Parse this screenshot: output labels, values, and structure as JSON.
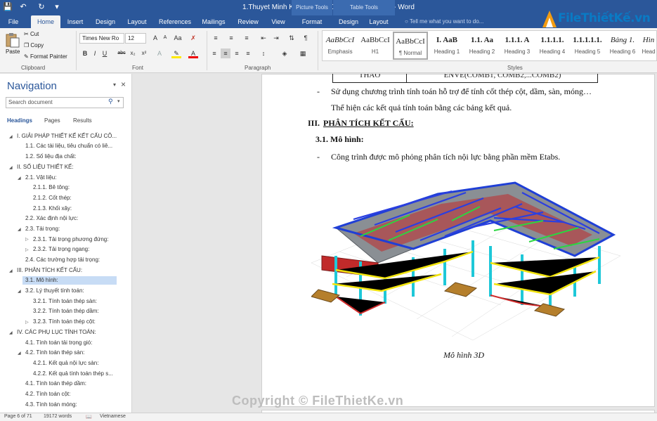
{
  "title": "1.Thuyet Minh KC (1).docx [Compatibility Mode] - Word",
  "context_tabs": {
    "picture": "Picture Tools",
    "table": "Table Tools"
  },
  "tabs": [
    "File",
    "Home",
    "Insert",
    "Design",
    "Layout",
    "References",
    "Mailings",
    "Review",
    "View",
    "Format",
    "Design",
    "Layout"
  ],
  "tell_me": "Tell me what you want to do...",
  "logo": "FileThiếtKế.vn",
  "clipboard": {
    "paste": "Paste",
    "cut": "Cut",
    "copy": "Copy",
    "format_painter": "Format Painter",
    "label": "Clipboard"
  },
  "font": {
    "name": "Times New Ro",
    "size": "12",
    "label": "Font"
  },
  "paragraph": {
    "label": "Paragraph"
  },
  "styles": {
    "label": "Styles",
    "items": [
      {
        "preview": "AaBbCcI",
        "name": "Emphasis"
      },
      {
        "preview": "AaBbCcI",
        "name": "H1"
      },
      {
        "preview": "AaBbCcI",
        "name": "¶ Normal"
      },
      {
        "preview": "I. AaB",
        "name": "Heading 1"
      },
      {
        "preview": "1.1. Aa",
        "name": "Heading 2"
      },
      {
        "preview": "1.1.1. A",
        "name": "Heading 3"
      },
      {
        "preview": "1.1.1.1.",
        "name": "Heading 4"
      },
      {
        "preview": "1.1.1.1.1.",
        "name": "Heading 5"
      },
      {
        "preview": "Bảng 1.",
        "name": "Heading 6"
      },
      {
        "preview": "Hìn",
        "name": "Head"
      }
    ]
  },
  "nav": {
    "title": "Navigation",
    "search_placeholder": "Search document",
    "tabs": [
      "Headings",
      "Pages",
      "Results"
    ],
    "items": [
      {
        "text": "I. GIẢI PHÁP THIẾT KẾ KẾT CẤU CÔ..."
      },
      {
        "text": "1.1. Các tài liệu, tiêu chuẩn có liê..."
      },
      {
        "text": "1.2. Số liệu địa chất:"
      },
      {
        "text": "II. SỐ LIỆU THIẾT KẾ:"
      },
      {
        "text": "2.1. Vật liệu:"
      },
      {
        "text": "2.1.1. Bê tông:"
      },
      {
        "text": "2.1.2. Cốt thép:"
      },
      {
        "text": "2.1.3. Khối xây:"
      },
      {
        "text": "2.2. Xác định nội lực:"
      },
      {
        "text": "2.3. Tải trọng:"
      },
      {
        "text": "2.3.1. Tải trọng phương đứng:"
      },
      {
        "text": "2.3.2. Tải trọng ngang:"
      },
      {
        "text": "2.4. Các trường hợp tải trọng:"
      },
      {
        "text": "III. PHÂN TÍCH KẾT CẤU:"
      },
      {
        "text": "3.1. Mô hình:"
      },
      {
        "text": "3.2. Lý thuyết tính toán:"
      },
      {
        "text": "3.2.1. Tính toán thép sàn:"
      },
      {
        "text": "3.2.2. Tính toán thép dầm:"
      },
      {
        "text": "3.2.3. Tính toán thép cột:"
      },
      {
        "text": "IV. CÁC PHỤ LỤC TÍNH TOÁN:"
      },
      {
        "text": "4.1. Tính toán tải trọng gió:"
      },
      {
        "text": "4.2. Tính toán thép sàn:"
      },
      {
        "text": "4.2.1. Kết quả nội lực sàn:"
      },
      {
        "text": "4.2.2. Kết quả tính toán thép s..."
      },
      {
        "text": "4.1. Tính toán thép dầm:"
      },
      {
        "text": "4.2. Tính toán cột:"
      },
      {
        "text": "4.3. Tính toán móng:"
      }
    ]
  },
  "document": {
    "table_cells": [
      "THÁO",
      "ENVE(COMB1, COMB2,...COMB2)"
    ],
    "bullet1": "Sử dụng chương trình tính toán hỗ trợ để tính cốt thép cột, dầm, sàn, móng…",
    "line2": "Thể hiện các kết quả tính toán bằng các bảng kết quả.",
    "heading_num": "III.",
    "heading": "PHÂN TÍCH KẾT CẤU:",
    "subheading": "3.1. Mô hình:",
    "bullet2": "Công trình được mô phỏng phân tích nội lực bằng phần mềm Etabs.",
    "bullet_mark": "-",
    "caption": "Mô hình 3D"
  },
  "status": {
    "page": "Page 6 of 71",
    "words": "19172 words",
    "language": "Vietnamese"
  },
  "watermark": "Copyright © FileThietKe.vn"
}
